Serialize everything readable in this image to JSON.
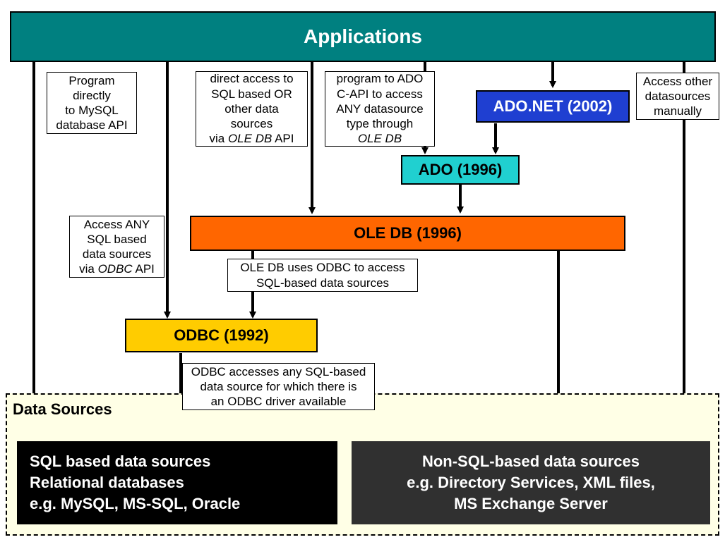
{
  "applications": {
    "title": "Applications"
  },
  "adonet": {
    "label": "ADO.NET (2002)"
  },
  "ado": {
    "label": "ADO (1996)"
  },
  "oledb": {
    "label": "OLE DB (1996)"
  },
  "odbc": {
    "label": "ODBC (1992)"
  },
  "datasources": {
    "title": "Data Sources",
    "sql_html": "SQL based data sources<br>Relational databases<br>e.g. MySQL, MS-SQL, Oracle",
    "nonsql_html": "Non-SQL-based data sources<br>e.g. Directory Services, XML files,<br>MS Exchange Server"
  },
  "callouts": {
    "c1_html": "Program<br>directly<br>to MySQL<br>database API",
    "c2_html": "direct access to<br>SQL based OR<br>other data<br>sources<br>via <span class=\"italic\">OLE DB</span> API",
    "c3_html": "program to ADO<br>C-API to access<br>ANY datasource<br>type through<br><span class=\"italic\">OLE DB</span>",
    "c4_html": "Access other<br>datasources<br>manually",
    "c5_html": "Access ANY<br>SQL based<br>data sources<br>via <span class=\"italic\">ODBC</span> API",
    "c6_html": "OLE DB uses ODBC to access<br>SQL-based data sources",
    "c7_html": "ODBC accesses any SQL-based<br>data source for which there is<br>an ODBC driver available"
  },
  "colors": {
    "applications": "#008080",
    "adonet": "#1F3FD1",
    "ado": "#20D0D0",
    "oledb": "#FF6600",
    "odbc": "#FFCC00",
    "ds_bg": "#FFFFE6",
    "sql_box": "#000000",
    "nonsql_box": "#303030"
  },
  "chart_data": {
    "type": "diagram",
    "title": "Data access technology stack from Applications to Data Sources",
    "nodes": [
      {
        "id": "applications",
        "label": "Applications"
      },
      {
        "id": "adonet",
        "label": "ADO.NET (2002)"
      },
      {
        "id": "ado",
        "label": "ADO (1996)"
      },
      {
        "id": "oledb",
        "label": "OLE DB (1996)"
      },
      {
        "id": "odbc",
        "label": "ODBC (1992)"
      },
      {
        "id": "sql_sources",
        "label": "SQL based data sources / Relational databases e.g. MySQL, MS-SQL, Oracle"
      },
      {
        "id": "nonsql_sources",
        "label": "Non-SQL-based data sources e.g. Directory Services, XML files, MS Exchange Server"
      }
    ],
    "edges": [
      {
        "from": "applications",
        "to": "sql_sources",
        "label": "Program directly to MySQL database API"
      },
      {
        "from": "applications",
        "to": "odbc",
        "label": "Access ANY SQL based data sources via ODBC API"
      },
      {
        "from": "applications",
        "to": "oledb",
        "label": "direct access to SQL based OR other data sources via OLE DB API"
      },
      {
        "from": "applications",
        "to": "ado",
        "label": "program to ADO C-API to access ANY datasource type through OLE DB"
      },
      {
        "from": "applications",
        "to": "adonet",
        "label": ""
      },
      {
        "from": "applications",
        "to": "nonsql_sources",
        "label": "Access other datasources manually"
      },
      {
        "from": "adonet",
        "to": "ado",
        "label": ""
      },
      {
        "from": "ado",
        "to": "oledb",
        "label": ""
      },
      {
        "from": "oledb",
        "to": "odbc",
        "label": "OLE DB uses ODBC to access SQL-based data sources"
      },
      {
        "from": "oledb",
        "to": "nonsql_sources",
        "label": ""
      },
      {
        "from": "odbc",
        "to": "sql_sources",
        "label": "ODBC accesses any SQL-based data source for which there is an ODBC driver available"
      }
    ]
  }
}
